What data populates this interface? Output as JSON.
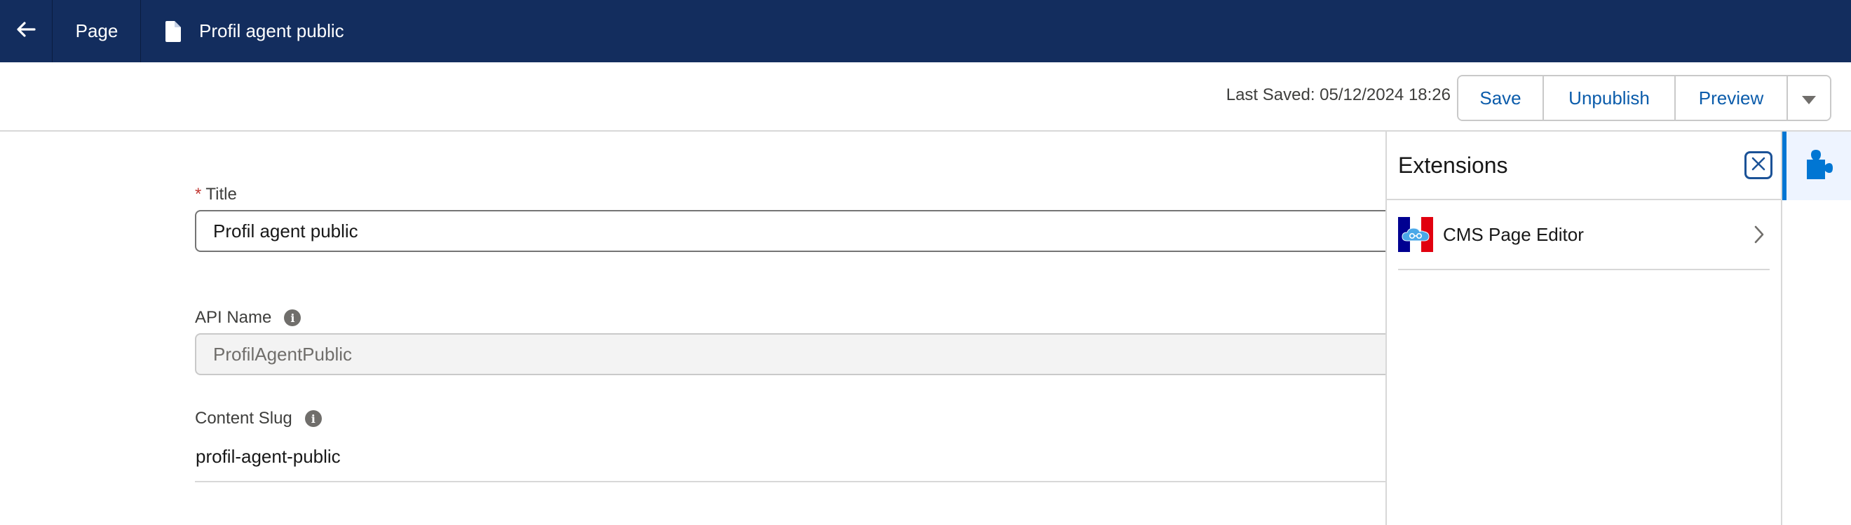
{
  "topbar": {
    "back_icon": "arrow-left-icon",
    "page_label": "Page",
    "doc_icon": "document-icon",
    "doc_title": "Profil agent public"
  },
  "toolbar": {
    "last_saved": "Last Saved: 05/12/2024 18:26",
    "save_label": "Save",
    "unpublish_label": "Unpublish",
    "preview_label": "Preview",
    "more_icon": "caret-down-icon"
  },
  "form": {
    "title": {
      "required_mark": "*",
      "label": "Title",
      "value": "Profil agent public"
    },
    "api_name": {
      "label": "API Name",
      "value": "ProfilAgentPublic"
    },
    "content_slug": {
      "label": "Content Slug",
      "value": "profil-agent-public"
    }
  },
  "extensions": {
    "title": "Extensions",
    "close_icon": "close-icon",
    "items": [
      {
        "label": "CMS Page Editor",
        "icon": "french-flag-cloud-logo"
      }
    ]
  },
  "rail": {
    "active_icon": "puzzle-piece-icon"
  },
  "colors": {
    "header_bg": "#132d5e",
    "link_blue": "#0b5cab",
    "accent_blue": "#0176d3",
    "required_red": "#c23934"
  }
}
